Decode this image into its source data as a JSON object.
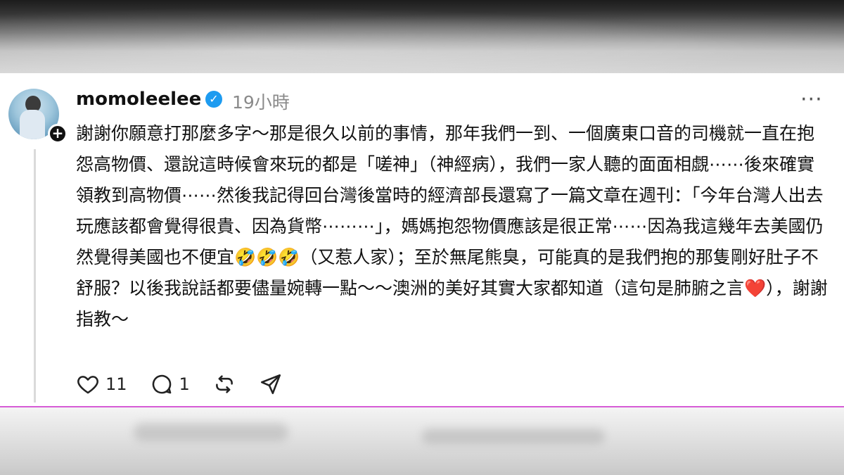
{
  "post": {
    "username": "momoleelee",
    "time": "19小時",
    "text": "謝謝你願意打那麼多字～那是很久以前的事情，那年我們一到、一個廣東口音的司機就一直在抱怨高物價、還說這時候會來玩的都是「嗟神」（神經病），我們一家人聽的面面相覷⋯⋯後來確實領教到高物價⋯⋯然後我記得回台灣後當時的經濟部長還寫了一篇文章在週刊：「今年台灣人出去玩應該都會覺得很貴、因為貨幣⋯⋯⋯」，媽媽抱怨物價應該是很正常⋯⋯因為我這幾年去美國仍然覺得美國也不便宜🤣🤣🤣（又惹人家）；至於無尾熊臭，可能真的是我們抱的那隻剛好肚子不舒服？以後我說話都要儘量婉轉一點～～澳洲的美好其實大家都知道（這句是肺腑之言❤️），謝謝指教～",
    "likes": "11",
    "replies": "1"
  },
  "colors": {
    "verified": "#1d9bf0",
    "timestamp": "#8a8a8a",
    "divider": "#d65bd6"
  },
  "icons": [
    "avatar",
    "plus-icon",
    "verified-icon",
    "more-icon",
    "heart-icon",
    "comment-icon",
    "repost-icon",
    "share-icon"
  ]
}
